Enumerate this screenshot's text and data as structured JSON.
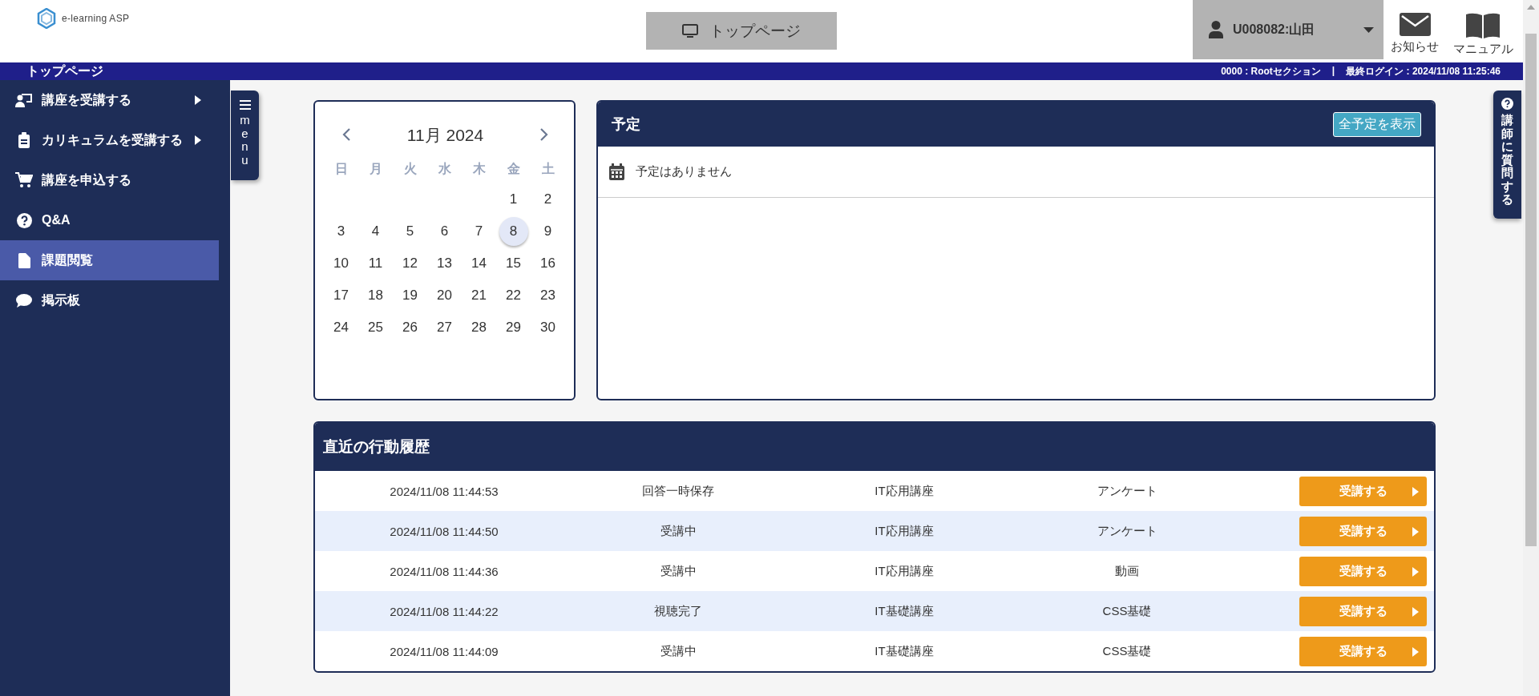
{
  "header": {
    "logo_text": "e-learning ASP",
    "top_button": "トップページ",
    "user": "U008082:山田",
    "notices": "お知らせ",
    "manual": "マニュアル"
  },
  "title_bar": {
    "title": "トップページ",
    "section": "0000 : Rootセクション",
    "separator": "|",
    "last_login": "最終ログイン : 2024/11/08 11:25:46"
  },
  "sidebar": {
    "items": [
      {
        "label": "講座を受講する",
        "kind": "teacher",
        "submenu": true,
        "selected": false
      },
      {
        "label": "カリキュラムを受講する",
        "kind": "clipboard",
        "submenu": true,
        "selected": false
      },
      {
        "label": "講座を申込する",
        "kind": "cart",
        "submenu": false,
        "selected": false
      },
      {
        "label": "Q&A",
        "kind": "question",
        "submenu": false,
        "selected": false
      },
      {
        "label": "課題閲覧",
        "kind": "file",
        "submenu": false,
        "selected": true
      },
      {
        "label": "掲示板",
        "kind": "chat",
        "submenu": false,
        "selected": false
      }
    ]
  },
  "menu_tab": {
    "label": "menu"
  },
  "calendar": {
    "month": "11月 2024",
    "weekdays": [
      "日",
      "月",
      "火",
      "水",
      "木",
      "金",
      "土"
    ],
    "weeks": [
      {
        "days": [
          {
            "day": "1",
            "selected": false
          },
          {
            "day": "2",
            "selected": false
          }
        ]
      },
      {
        "days": [
          {
            "day": "3",
            "selected": false
          },
          {
            "day": "4",
            "selected": false
          },
          {
            "day": "5",
            "selected": false
          },
          {
            "day": "6",
            "selected": false
          },
          {
            "day": "7",
            "selected": false
          },
          {
            "day": "8",
            "selected": true
          },
          {
            "day": "9",
            "selected": false
          }
        ]
      },
      {
        "days": [
          {
            "day": "10",
            "selected": false
          },
          {
            "day": "11",
            "selected": false
          },
          {
            "day": "12",
            "selected": false
          },
          {
            "day": "13",
            "selected": false
          },
          {
            "day": "14",
            "selected": false
          },
          {
            "day": "15",
            "selected": false
          },
          {
            "day": "16",
            "selected": false
          }
        ]
      },
      {
        "days": [
          {
            "day": "17",
            "selected": false
          },
          {
            "day": "18",
            "selected": false
          },
          {
            "day": "19",
            "selected": false
          },
          {
            "day": "20",
            "selected": false
          },
          {
            "day": "21",
            "selected": false
          },
          {
            "day": "22",
            "selected": false
          },
          {
            "day": "23",
            "selected": false
          }
        ]
      },
      {
        "days": [
          {
            "day": "24",
            "selected": false
          },
          {
            "day": "25",
            "selected": false
          },
          {
            "day": "26",
            "selected": false
          },
          {
            "day": "27",
            "selected": false
          },
          {
            "day": "28",
            "selected": false
          },
          {
            "day": "29",
            "selected": false
          },
          {
            "day": "30",
            "selected": false
          }
        ]
      }
    ]
  },
  "schedule": {
    "title": "予定",
    "show_all_button": "全予定を表示",
    "empty_message": "予定はありません"
  },
  "history": {
    "title": "直近の行動履歴",
    "rows": [
      {
        "datetime": "2024/11/08 11:44:53",
        "action": "回答一時保存",
        "course": "IT応用講座",
        "content": "アンケート",
        "button": "受講する"
      },
      {
        "datetime": "2024/11/08 11:44:50",
        "action": "受講中",
        "course": "IT応用講座",
        "content": "アンケート",
        "button": "受講する"
      },
      {
        "datetime": "2024/11/08 11:44:36",
        "action": "受講中",
        "course": "IT応用講座",
        "content": "動画",
        "button": "受講する"
      },
      {
        "datetime": "2024/11/08 11:44:22",
        "action": "視聴完了",
        "course": "IT基礎講座",
        "content": "CSS基礎",
        "button": "受講する"
      },
      {
        "datetime": "2024/11/08 11:44:09",
        "action": "受講中",
        "course": "IT基礎講座",
        "content": "CSS基礎",
        "button": "受講する"
      }
    ]
  },
  "ask_tab": {
    "label": "講師に質問する"
  }
}
